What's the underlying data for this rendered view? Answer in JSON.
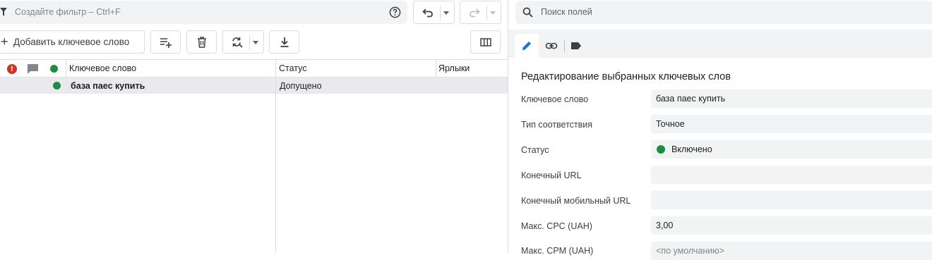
{
  "filter": {
    "placeholder": "Создайте фильтр – Ctrl+F"
  },
  "toolbar": {
    "add_keyword_label": "Добавить ключевое слово"
  },
  "grid": {
    "headers": {
      "keyword": "Ключевое слово",
      "status": "Статус",
      "labels": "Ярлыки"
    },
    "rows": [
      {
        "keyword": "база паес купить",
        "status": "Допущено",
        "labels": ""
      }
    ]
  },
  "panel": {
    "search_placeholder": "Поиск полей",
    "title": "Редактирование выбранных ключевых слов",
    "fields": [
      {
        "label": "Ключевое слово",
        "value": "база паес купить"
      },
      {
        "label": "Тип соответствия",
        "value": "Точное"
      },
      {
        "label": "Статус",
        "value": "Включено"
      },
      {
        "label": "Конечный URL",
        "value": ""
      },
      {
        "label": "Конечный мобильный URL",
        "value": ""
      },
      {
        "label": "Макс. CPC (UAH)",
        "value": "3,00"
      },
      {
        "label": "Макс. CPM (UAH)",
        "value": "<по умолчанию>"
      }
    ]
  },
  "colors": {
    "accent": "#1a73e8",
    "enabled_green": "#1e8e3e",
    "error_red": "#d93025",
    "row_selected": "#e8eaed"
  }
}
